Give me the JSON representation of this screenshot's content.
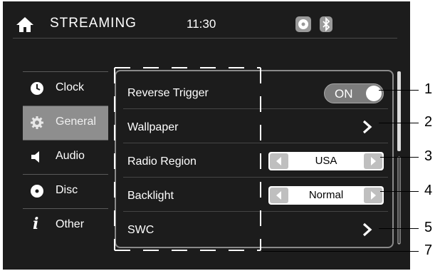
{
  "header": {
    "title": "STREAMING",
    "time": "11:30",
    "icons": [
      "home-icon",
      "disc-status-icon",
      "bluetooth-icon"
    ]
  },
  "sidebar": {
    "items": [
      {
        "label": "Clock",
        "icon": "clock-icon"
      },
      {
        "label": "General",
        "icon": "gear-icon",
        "active": true
      },
      {
        "label": "Audio",
        "icon": "speaker-icon"
      },
      {
        "label": "Disc",
        "icon": "disc-icon"
      },
      {
        "label": "Other",
        "icon": "info-icon"
      }
    ]
  },
  "settings": {
    "reverse_trigger": {
      "label": "Reverse Trigger",
      "state": "ON"
    },
    "wallpaper": {
      "label": "Wallpaper"
    },
    "radio_region": {
      "label": "Radio Region",
      "value": "USA"
    },
    "backlight": {
      "label": "Backlight",
      "value": "Normal"
    },
    "swc": {
      "label": "SWC"
    }
  },
  "callouts": [
    "1",
    "2",
    "3",
    "4",
    "5",
    "7"
  ],
  "colors": {
    "screen_bg": "#1c1c1c",
    "active_tab": "#8e8e8e",
    "toggle_bg": "#7c7c7c"
  }
}
